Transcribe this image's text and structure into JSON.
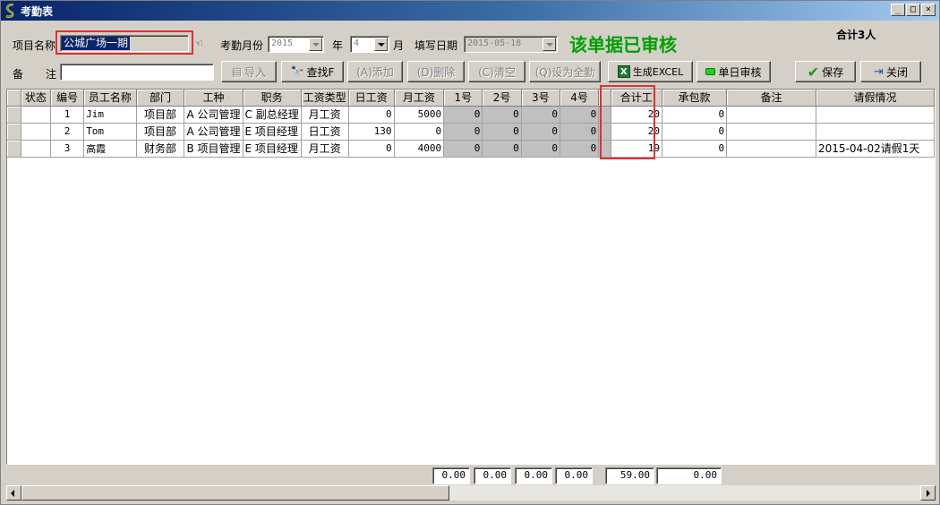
{
  "window": {
    "title": "考勤表",
    "buttons": {
      "minimize": "_",
      "maximize": "□",
      "close": "×"
    }
  },
  "form": {
    "project_label": "项目名称",
    "project_value": "公城广场一期",
    "month_label": "考勤月份",
    "year_value": "2015",
    "year_unit": "年",
    "month_value": "4",
    "month_unit": "月",
    "fill_date_label": "填写日期",
    "fill_date_value": "2015-05-18",
    "status_text": "该单据已审核",
    "total_people": "合计3人",
    "remark_label_1": "备",
    "remark_label_2": "注",
    "remark_value": ""
  },
  "toolbar": {
    "import": "导入",
    "find": "查找F",
    "add": "(A)添加",
    "delete": "(D)删除",
    "clear": "(C)清空",
    "set_all": "(Q)设为全勤",
    "excel": "生成EXCEL",
    "single_day_audit": "单日审核",
    "save": "保存",
    "close": "关闭"
  },
  "colors": {
    "accent_green": "#00a000",
    "highlight_red": "#e03030",
    "selection_blue": "#0a246a"
  },
  "table": {
    "headers": [
      "状态",
      "编号",
      "员工名称",
      "部门",
      "工种",
      "职务",
      "工资类型",
      "日工资",
      "月工资",
      "1号",
      "2号",
      "3号",
      "4号",
      "合计工",
      "承包款",
      "备注",
      "请假情况"
    ],
    "rows": [
      {
        "status": "",
        "no": "1",
        "name": "Jim",
        "dept": "项目部",
        "trade": "A 公司管理",
        "position": "C 副总经理",
        "wage_type": "月工资",
        "daily": "0",
        "monthly": "5000",
        "d1": "0",
        "d2": "0",
        "d3": "0",
        "d4": "0",
        "total_work": "20",
        "contract": "0",
        "remark": "",
        "leave": ""
      },
      {
        "status": "",
        "no": "2",
        "name": "Tom",
        "dept": "项目部",
        "trade": "A 公司管理",
        "position": "E 项目经理",
        "wage_type": "日工资",
        "daily": "130",
        "monthly": "0",
        "d1": "0",
        "d2": "0",
        "d3": "0",
        "d4": "0",
        "total_work": "20",
        "contract": "0",
        "remark": "",
        "leave": ""
      },
      {
        "status": "",
        "no": "3",
        "name": "高霞",
        "dept": "财务部",
        "trade": "B 项目管理",
        "position": "E 项目经理",
        "wage_type": "月工资",
        "daily": "0",
        "monthly": "4000",
        "d1": "0",
        "d2": "0",
        "d3": "0",
        "d4": "0",
        "total_work": "19",
        "contract": "0",
        "remark": "",
        "leave": "2015-04-02请假1天"
      }
    ]
  },
  "footer": {
    "d1": "0.00",
    "d2": "0.00",
    "d3": "0.00",
    "d4": "0.00",
    "total_work": "59.00",
    "contract": "0.00"
  }
}
